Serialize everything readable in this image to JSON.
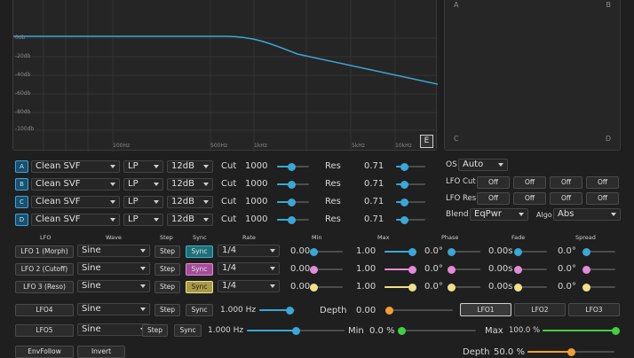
{
  "colors": {
    "accent": "#3aa7d8",
    "lfo1": "#3aa7d8",
    "lfo2": "#e58ad8",
    "lfo3": "#f0e08a",
    "lfo4": "#f0a030",
    "lfo5": "#40d040",
    "sync_on1": "#1f6f7a",
    "sync_on2": "#b05ba8",
    "sync_on3": "#c7b860"
  },
  "graph": {
    "db_labels": [
      "0db",
      "-20db",
      "-40db",
      "-60db",
      "-80db",
      "-100db"
    ],
    "hz_labels": [
      "100Hz",
      "500Hz",
      "1kHz",
      "5kHz",
      "10kHz"
    ],
    "e_button": "E"
  },
  "xy_pad": {
    "a": "A",
    "b": "B",
    "c": "C",
    "d": "D"
  },
  "filters": [
    {
      "letter": "A",
      "type": "Clean SVF",
      "mode": "LP",
      "slope": "12dB",
      "cut_label": "Cut",
      "cut_value": "1000",
      "cut_pos": 0.45,
      "res_label": "Res",
      "res_value": "0.71",
      "res_pos": 0.3
    },
    {
      "letter": "B",
      "type": "Clean SVF",
      "mode": "LP",
      "slope": "12dB",
      "cut_label": "Cut",
      "cut_value": "1000",
      "cut_pos": 0.45,
      "res_label": "Res",
      "res_value": "0.71",
      "res_pos": 0.3
    },
    {
      "letter": "C",
      "type": "Clean SVF",
      "mode": "LP",
      "slope": "12dB",
      "cut_label": "Cut",
      "cut_value": "1000",
      "cut_pos": 0.45,
      "res_label": "Res",
      "res_value": "0.71",
      "res_pos": 0.3
    },
    {
      "letter": "D",
      "type": "Clean SVF",
      "mode": "LP",
      "slope": "12dB",
      "cut_label": "Cut",
      "cut_value": "1000",
      "cut_pos": 0.45,
      "res_label": "Res",
      "res_value": "0.71",
      "res_pos": 0.3
    }
  ],
  "right_panel": {
    "os_label": "OS",
    "os_value": "Auto",
    "lfo_cut_label": "LFO Cut",
    "lfo_cut_buttons": [
      "Off",
      "Off",
      "Off",
      "Off"
    ],
    "lfo_res_label": "LFO Res",
    "lfo_res_buttons": [
      "Off",
      "Off",
      "Off",
      "Off"
    ],
    "blend_label": "Blend",
    "blend_value": "EqPwr",
    "algo_label": "Algo",
    "algo_value": "Abs"
  },
  "lfo_headers": {
    "lfo": "LFO",
    "wave": "Wave",
    "step": "Step",
    "sync": "Sync",
    "rate": "Rate",
    "min": "Min",
    "max": "Max",
    "phase": "Phase",
    "fade": "Fade",
    "spread": "Spread"
  },
  "lfos": [
    {
      "name": "LFO 1 (Morph)",
      "wave": "Sine",
      "step": "Step",
      "sync": "Sync",
      "rate": "1/4",
      "min": "0.00",
      "min_pos": 0.0,
      "max": "1.00",
      "max_pos": 1.0,
      "phase": "0.0°",
      "phase_pos": 0.0,
      "fade": "0.00s",
      "fade_pos": 0.0,
      "spread": "0.0°",
      "spread_pos": 0.0
    },
    {
      "name": "LFO 2 (Cutoff)",
      "wave": "Sine",
      "step": "Step",
      "sync": "Sync",
      "rate": "1/4",
      "min": "0.00",
      "min_pos": 0.0,
      "max": "1.00",
      "max_pos": 1.0,
      "phase": "0.0°",
      "phase_pos": 0.0,
      "fade": "0.00s",
      "fade_pos": 0.0,
      "spread": "0.0°",
      "spread_pos": 0.0
    },
    {
      "name": "LFO 3 (Reso)",
      "wave": "Sine",
      "step": "Step",
      "sync": "Sync",
      "rate": "1/4",
      "min": "0.00",
      "min_pos": 0.0,
      "max": "1.00",
      "max_pos": 1.0,
      "phase": "0.0°",
      "phase_pos": 0.0,
      "fade": "0.00s",
      "fade_pos": 0.0,
      "spread": "0.0°",
      "spread_pos": 0.0
    }
  ],
  "lfo4": {
    "name": "LFO4",
    "wave": "Sine",
    "step": "Step",
    "sync": "Sync",
    "rate": "1.000 Hz",
    "rate_pos": 0.85,
    "depth_label": "Depth",
    "depth_value": "0.00",
    "depth_pos": 0.0,
    "tabs": [
      "LFO1",
      "LFO2",
      "LFO3"
    ]
  },
  "lfo5": {
    "name": "LFO5",
    "wave": "Sine",
    "step": "Step",
    "sync": "Sync",
    "rate": "1.000 Hz",
    "rate_pos": 0.5,
    "min_label": "Min",
    "min_value": "0.0 %",
    "min_pos": 0.0,
    "max_label": "Max",
    "max_value": "100.0 %",
    "max_pos": 1.0
  },
  "bottom": {
    "envfollow": "EnvFollow",
    "invert": "Invert",
    "depth_label": "Depth",
    "depth_value": "50.0 %"
  }
}
